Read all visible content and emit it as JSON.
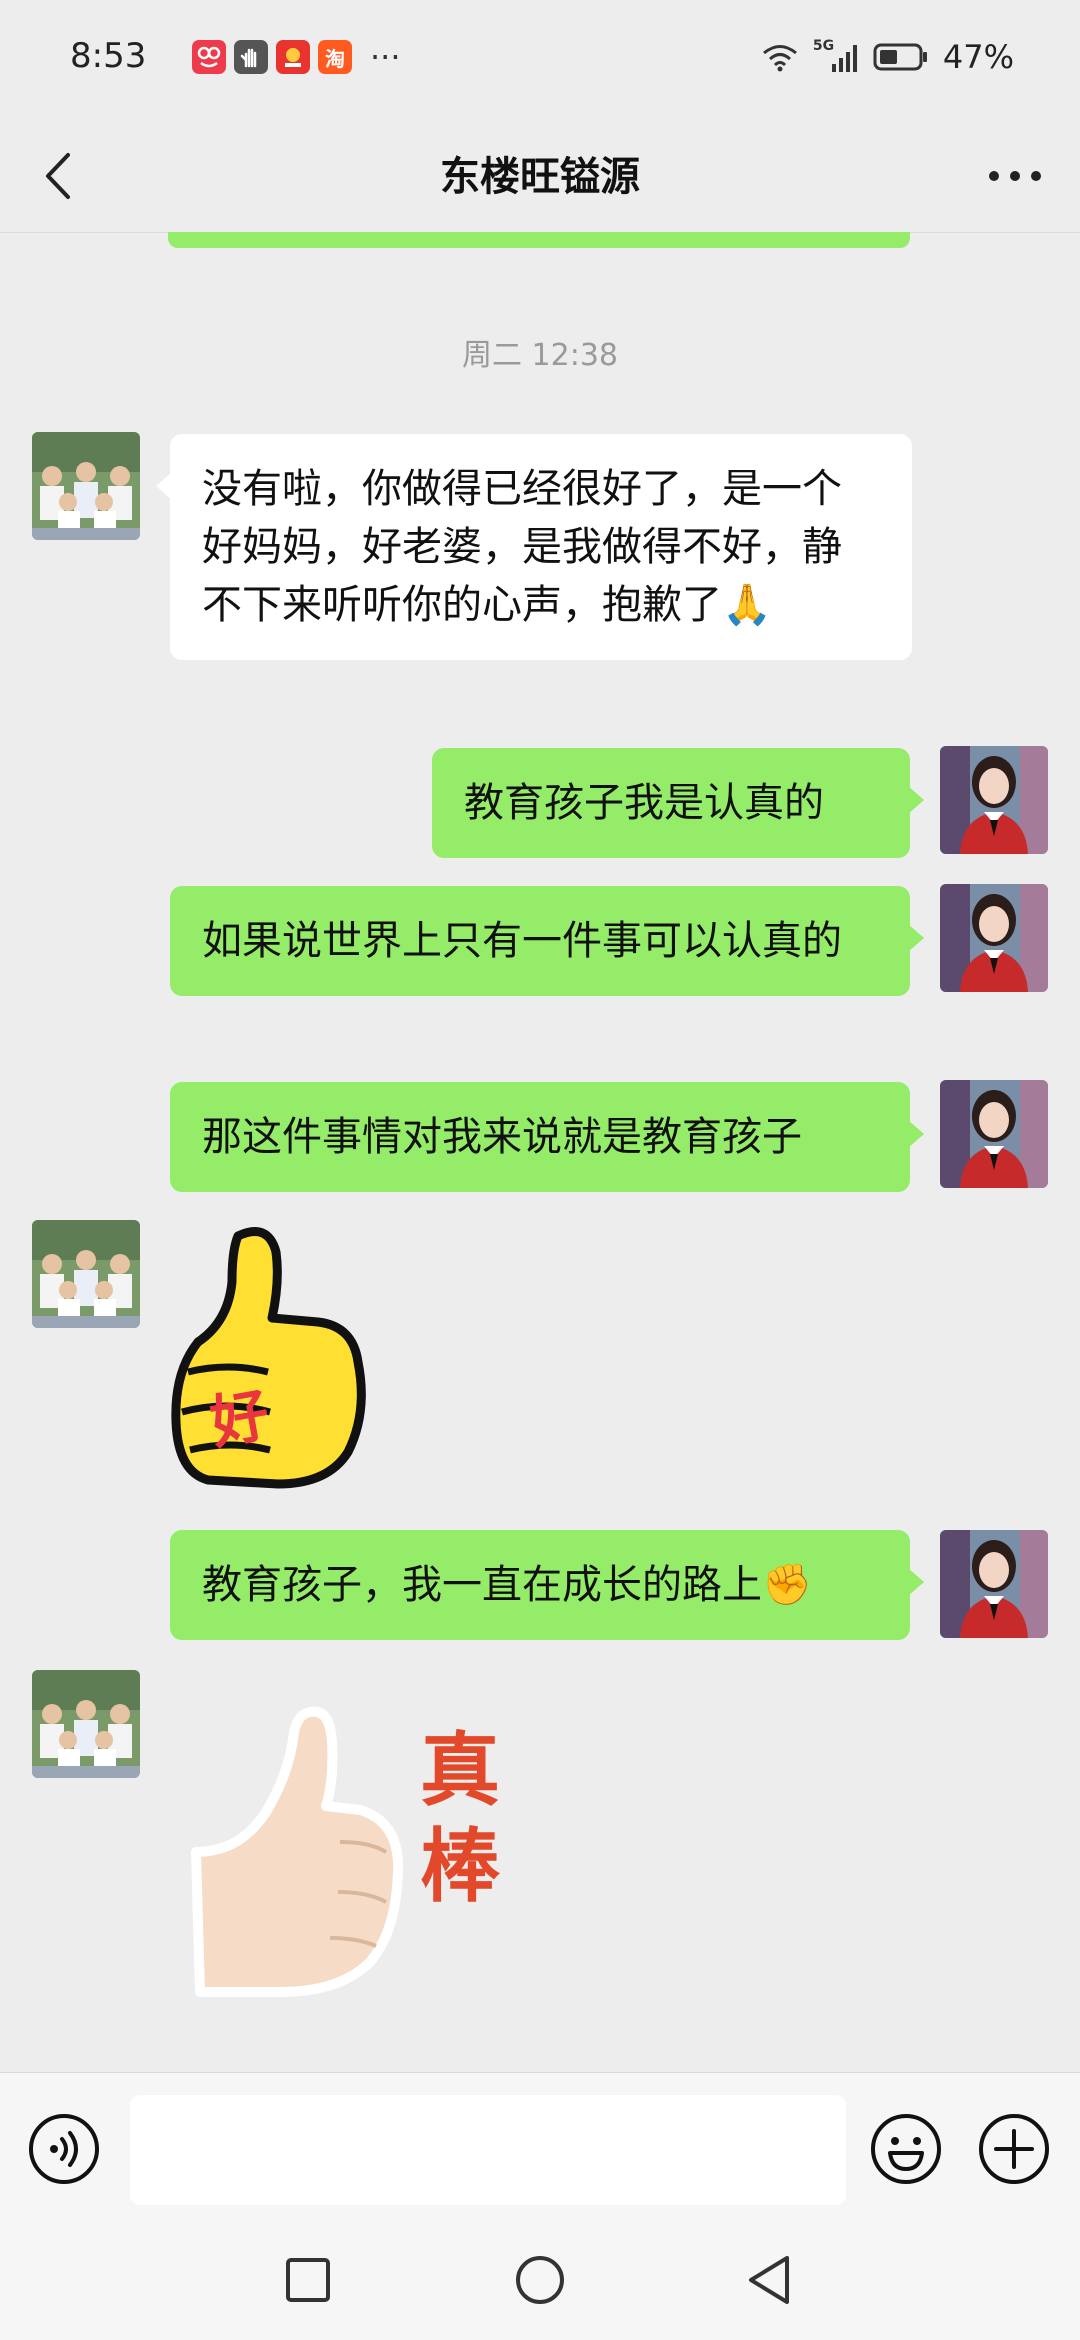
{
  "status_bar": {
    "time": "8:53",
    "notification_apps": [
      "pinduoduo-app",
      "hand-app",
      "video-app",
      "taobao-app"
    ],
    "taobao_glyph": "淘",
    "overflow": "···",
    "network": "5G",
    "battery_percent": "47%",
    "battery_level": 0.47
  },
  "header": {
    "title": "东楼旺镒源",
    "back_icon": "chevron-left-icon",
    "more_icon": "more-horizontal-icon"
  },
  "chat": {
    "timestamp": "周二 12:38",
    "messages": [
      {
        "side": "left",
        "type": "text",
        "text": "没有啦，你做得已经很好了，是一个好妈妈，好老婆，是我做得不好，静不下来听听你的心声，抱歉了🙏"
      },
      {
        "side": "right",
        "type": "text",
        "text": "教育孩子我是认真的"
      },
      {
        "side": "right",
        "type": "text",
        "text": "如果说世界上只有一件事可以认真的"
      },
      {
        "side": "right",
        "type": "text",
        "text": "那这件事情对我来说就是教育孩子"
      },
      {
        "side": "left",
        "type": "sticker",
        "sticker": "thumbs-up-good-sticker",
        "caption": "好"
      },
      {
        "side": "right",
        "type": "text",
        "text": "教育孩子，我一直在成长的路上✊"
      },
      {
        "side": "left",
        "type": "sticker",
        "sticker": "thumbs-up-great-sticker",
        "caption": "真\n棒"
      }
    ]
  },
  "input_bar": {
    "voice_icon": "voice-icon",
    "input_value": "",
    "emoji_icon": "emoji-icon",
    "plus_icon": "plus-icon"
  },
  "nav_bar": {
    "recent_icon": "square-icon",
    "home_icon": "circle-icon",
    "back_icon": "triangle-back-icon"
  },
  "colors": {
    "background": "#ededed",
    "green_bubble": "#95ec69",
    "white_bubble": "#ffffff"
  }
}
